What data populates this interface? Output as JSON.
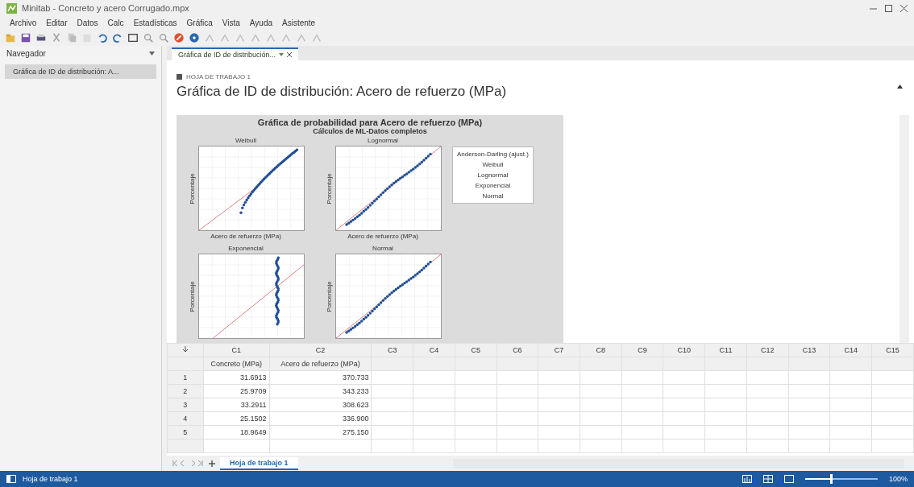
{
  "window": {
    "title": "Minitab - Concreto y acero Corrugado.mpx"
  },
  "menu": [
    "Archivo",
    "Editar",
    "Datos",
    "Calc",
    "Estadísticas",
    "Gráfica",
    "Vista",
    "Ayuda",
    "Asistente"
  ],
  "navigator": {
    "title": "Navegador",
    "items": [
      {
        "label": "Gráfica de ID de distribución: A...",
        "selected": true
      }
    ]
  },
  "doc_tabs": [
    {
      "label": "Gráfica de ID de distribución...",
      "selected": true
    }
  ],
  "output": {
    "worksheet_label": "HOJA DE TRABAJO 1",
    "title": "Gráfica de ID de distribución: Acero de refuerzo (MPa)",
    "graph": {
      "title": "Gráfica de probabilidad para Acero de refuerzo (MPa)",
      "subtitle": "Cálculos de ML-Datos completos",
      "plots": [
        {
          "title": "Weibull",
          "ylabel": "Porcentaje",
          "xlabel": "Acero de refuerzo (MPa)",
          "kind": "curve"
        },
        {
          "title": "Lognormal",
          "ylabel": "Porcentaje",
          "xlabel": "Acero de refuerzo (MPa)",
          "kind": "straight"
        },
        {
          "title": "Exponencial",
          "ylabel": "Porcentaje",
          "kind": "vertical"
        },
        {
          "title": "Normal",
          "ylabel": "Porcentaje",
          "kind": "straight"
        }
      ],
      "legend": [
        "Anderson-Darling (ajust.)",
        "Weibull",
        "Lognormal",
        "Exponencial",
        "Normal"
      ]
    }
  },
  "worksheet": {
    "columns": [
      "C1",
      "C2",
      "C3",
      "C4",
      "C5",
      "C6",
      "C7",
      "C8",
      "C9",
      "C10",
      "C11",
      "C12",
      "C13",
      "C14",
      "C15"
    ],
    "names": [
      "Concreto (MPa)",
      "Acero de refuerzo (MPa)"
    ],
    "rows": [
      {
        "n": "1",
        "cells": [
          "31.6913",
          "370.733"
        ]
      },
      {
        "n": "2",
        "cells": [
          "25.9709",
          "343.233"
        ]
      },
      {
        "n": "3",
        "cells": [
          "33.2911",
          "308.623"
        ]
      },
      {
        "n": "4",
        "cells": [
          "25.1502",
          "336.900"
        ]
      },
      {
        "n": "5",
        "cells": [
          "18.9649",
          "275.150"
        ]
      }
    ]
  },
  "sheet_tabs": [
    {
      "label": "Hoja de trabajo 1",
      "selected": true
    }
  ],
  "status_bar": {
    "text": "Hoja de trabajo 1",
    "zoom": "100%",
    "level": 0.35
  }
}
